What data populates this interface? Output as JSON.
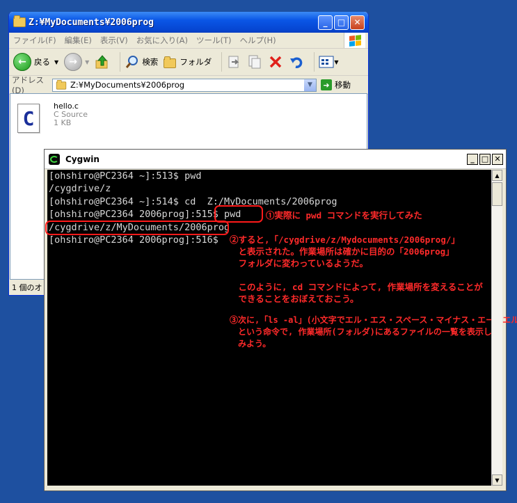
{
  "explorer": {
    "title": "Z:¥MyDocuments¥2006prog",
    "buttons": {
      "minimize": "_",
      "maximize": "□",
      "close": "✕"
    },
    "menu": [
      "ファイル(F)",
      "編集(E)",
      "表示(V)",
      "お気に入り(A)",
      "ツール(T)",
      "ヘルプ(H)"
    ],
    "toolbar": {
      "back": "戻る",
      "search": "検索",
      "folders": "フォルダ"
    },
    "address": {
      "label": "アドレス(D)",
      "value": "Z:¥MyDocuments¥2006prog",
      "go": "移動"
    },
    "file": {
      "icon_letter": "C",
      "name": "hello.c",
      "type": "C Source",
      "size": "1 KB"
    },
    "status": "1 個のオ"
  },
  "cygwin": {
    "title": "Cygwin",
    "buttons": {
      "minimize": "_",
      "maximize": "□",
      "close": "✕"
    },
    "lines": [
      "[ohshiro@PC2364 ~]:513$ pwd",
      "/cygdrive/z",
      "[ohshiro@PC2364 ~]:514$ cd  Z:/MyDocuments/2006prog",
      "[ohshiro@PC2364 2006prog]:515$ pwd",
      "/cygdrive/z/MyDocuments/2006prog",
      "[ohshiro@PC2364 2006prog]:516$ "
    ]
  },
  "annotations": {
    "note1": "①実際に pwd コマンドを実行してみた",
    "note2": "②すると,「/cygdrive/z/Mydocuments/2006prog/」\n　と表示された。作業場所は確かに目的の「2006prog」\n　フォルダに変わっているようだ。\n\n　このように, cd コマンドによって, 作業場所を変えることが\n　できることをおぼえておこう。",
    "note3": "③次に,「ls -al」(小文字でエル・エス・スペース・マイナス・エー・エル)\n　という命令で, 作業場所(フォルダ)にあるファイルの一覧を表示して\n　みよう。"
  }
}
